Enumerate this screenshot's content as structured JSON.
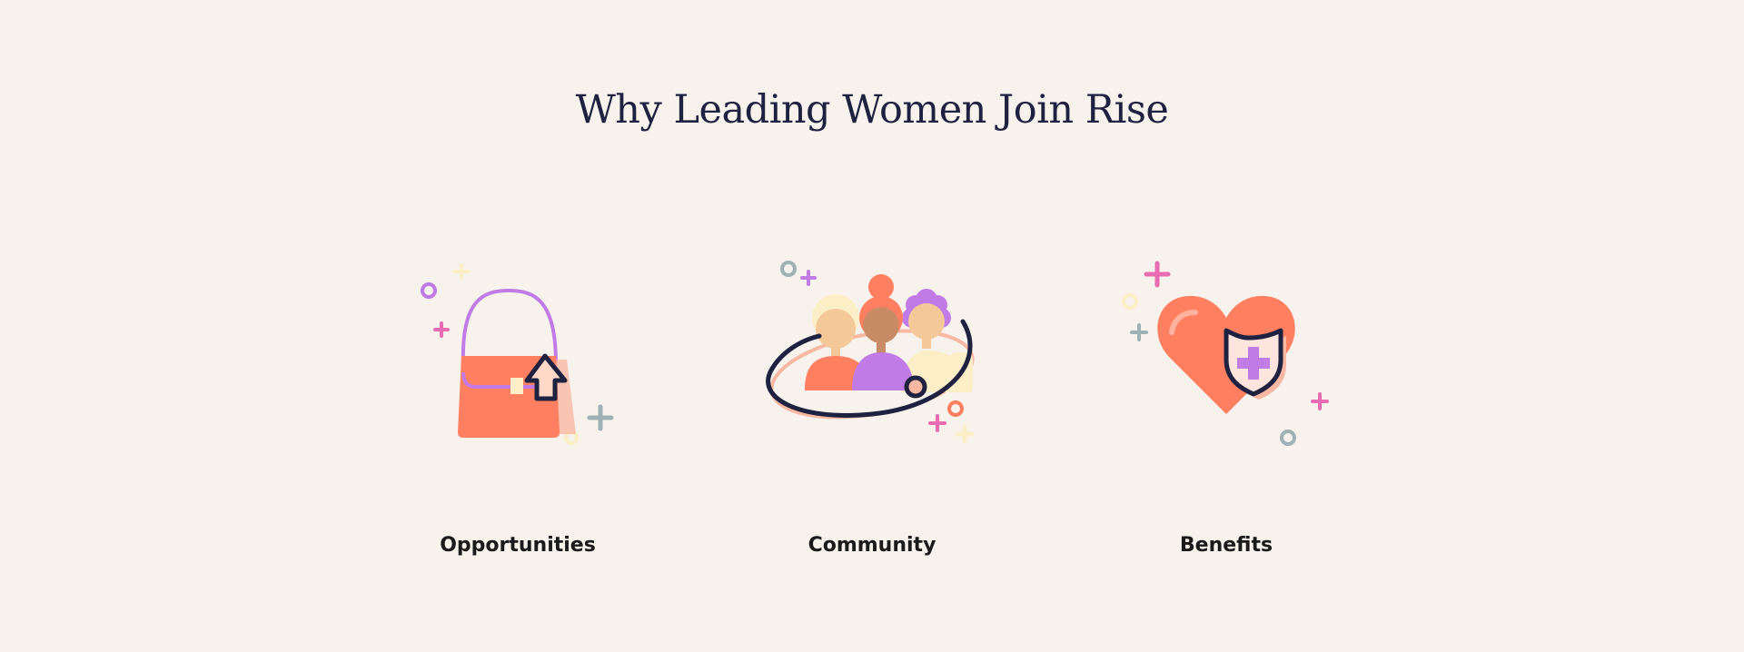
{
  "section": {
    "title": "Why Leading Women Join Rise",
    "cards": [
      {
        "label": "Opportunities",
        "icon": "handbag-upload-icon"
      },
      {
        "label": "Community",
        "icon": "women-group-icon"
      },
      {
        "label": "Benefits",
        "icon": "heart-shield-icon"
      }
    ]
  },
  "colors": {
    "background": "#f7f2ec",
    "title": "#1e2140",
    "coral": "#ff7f60",
    "purple": "#c17be6",
    "pink": "#e96bb2",
    "slate": "#9eb1b5",
    "cream": "#fcefc8",
    "navy": "#1e2140"
  }
}
